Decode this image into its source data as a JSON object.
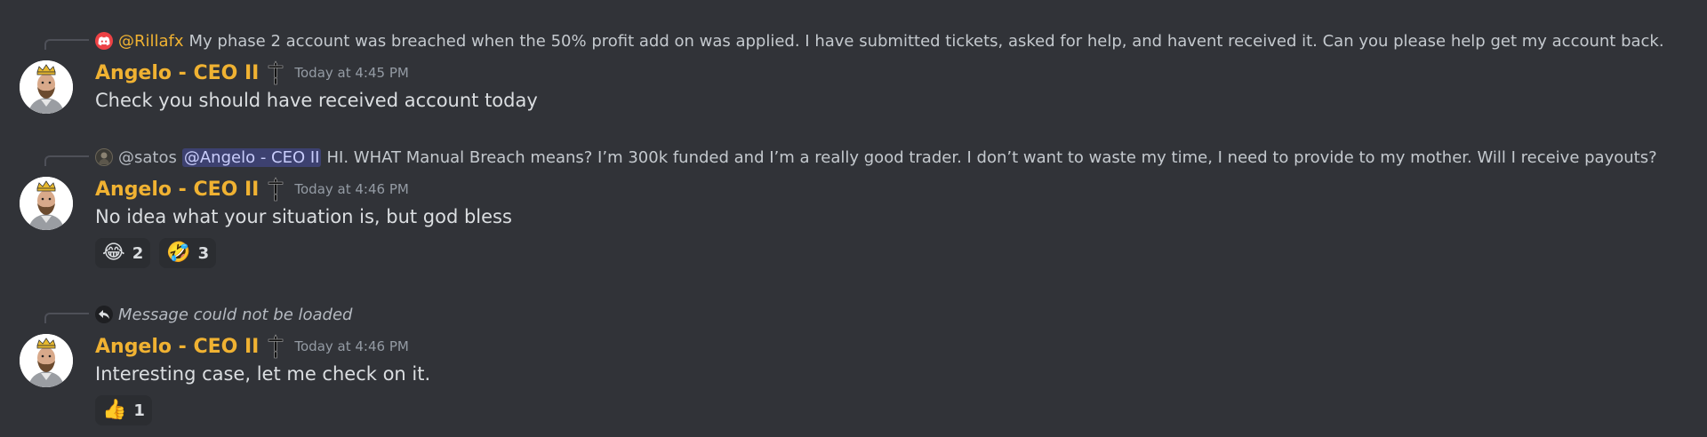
{
  "colors": {
    "background": "#313338",
    "username": "#f0b232",
    "mention_bg": "#3c4270",
    "timestamp": "#949ba4"
  },
  "messages": [
    {
      "reply": {
        "avatar_icon": "discord-logo-icon",
        "author": "@Rillafx",
        "text": "My phase 2 account was breached when the 50% profit add on was applied. I have submitted tickets, asked for help, and havent received it. Can you please help get my account back."
      },
      "author": "Angelo - CEO II",
      "role_icon": "dagger-icon",
      "timestamp": "Today at 4:45 PM",
      "content": "Check you should have received account today",
      "reactions": []
    },
    {
      "reply": {
        "avatar_icon": "satos-avatar",
        "author": "@satos",
        "mention": "@Angelo - CEO II",
        "text": "HI. WHAT Manual Breach means? I’m 300k funded and I’m a really good trader. I don’t want to waste my time, I need to provide to my mother. Will I receive payouts?"
      },
      "author": "Angelo - CEO II",
      "role_icon": "dagger-icon",
      "timestamp": "Today at 4:46 PM",
      "content": "No idea what your situation is, but god bless",
      "reactions": [
        {
          "emoji": "😂",
          "name": "joy",
          "count": "2"
        },
        {
          "emoji": "🤣",
          "name": "rofl",
          "count": "3"
        }
      ]
    },
    {
      "reply": {
        "avatar_icon": "reply-arrow-icon",
        "text": "Message could not be loaded"
      },
      "author": "Angelo - CEO II",
      "role_icon": "dagger-icon",
      "timestamp": "Today at 4:46 PM",
      "content": "Interesting case, let me check on it.",
      "reactions": [
        {
          "emoji": "👍",
          "name": "thumbs-up",
          "count": "1"
        }
      ]
    }
  ]
}
